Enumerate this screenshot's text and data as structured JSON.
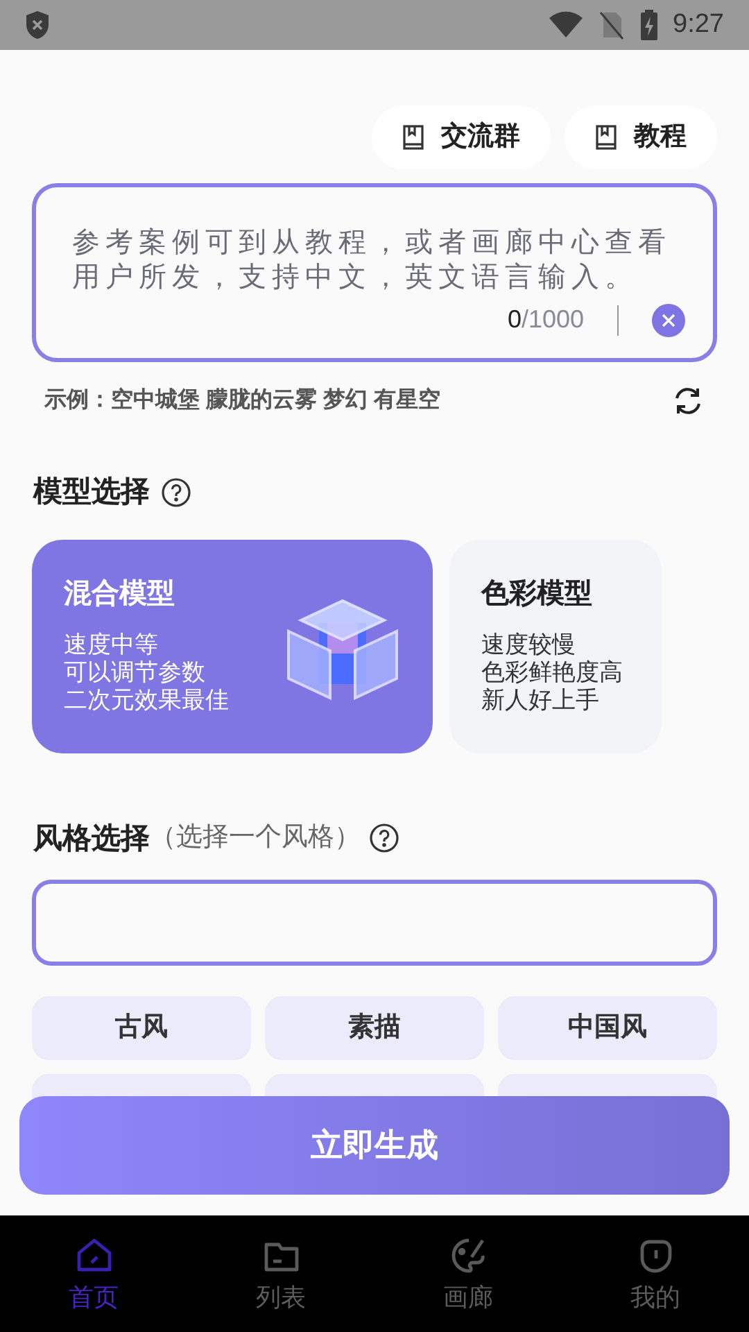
{
  "status_bar": {
    "time": "9:27"
  },
  "top_links": [
    {
      "label": "交流群"
    },
    {
      "label": "教程"
    }
  ],
  "prompt": {
    "placeholder": "参考案例可到从教程，或者画廊中心查看用户所发，支持中文，英文语言输入。",
    "count": "0",
    "limit": "/1000"
  },
  "example": {
    "text": "示例：空中城堡 朦胧的云雾 梦幻 有星空"
  },
  "model_section": {
    "title": "模型选择"
  },
  "models": [
    {
      "name": "混合模型",
      "lines": [
        "速度中等",
        "可以调节参数",
        "二次元效果最佳"
      ],
      "selected": true
    },
    {
      "name": "色彩模型",
      "lines": [
        "速度较慢",
        "色彩鲜艳度高",
        "新人好上手"
      ],
      "selected": false
    }
  ],
  "style_section": {
    "title": "风格选择",
    "hint": "（选择一个风格）"
  },
  "styles": [
    {
      "label": "古风"
    },
    {
      "label": "素描"
    },
    {
      "label": "中国风"
    }
  ],
  "generate_button": {
    "label": "立即生成"
  },
  "nav": [
    {
      "label": "首页",
      "kind": "home",
      "selected": true
    },
    {
      "label": "列表",
      "kind": "folder",
      "selected": false
    },
    {
      "label": "画廊",
      "kind": "palette",
      "selected": false
    },
    {
      "label": "我的",
      "kind": "profile",
      "selected": false
    }
  ]
}
